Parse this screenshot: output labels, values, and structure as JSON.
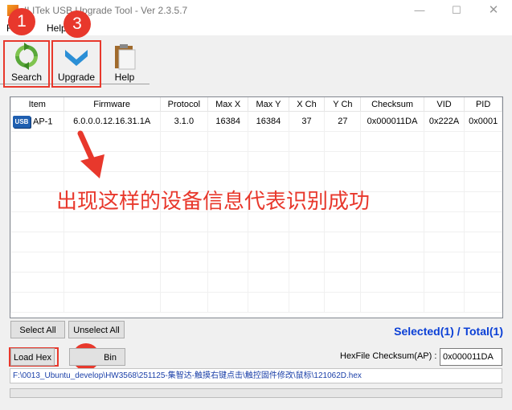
{
  "window": {
    "title": "ILITek USB Upgrade Tool - Ver 2.3.5.7"
  },
  "menu": {
    "items": [
      {
        "label": "File"
      },
      {
        "label": "Help"
      }
    ]
  },
  "toolbar": {
    "search_label": "Search",
    "upgrade_label": "Upgrade",
    "help_label": "Help"
  },
  "badges": {
    "one": "1",
    "two": "2",
    "three": "3"
  },
  "table": {
    "columns": [
      "Item",
      "Firmware",
      "Protocol",
      "Max X",
      "Max Y",
      "X Ch",
      "Y Ch",
      "Checksum",
      "VID",
      "PID"
    ],
    "rows": [
      {
        "icon": "usb-icon",
        "icon_text": "USB",
        "item": "AP-1",
        "firmware": "6.0.0.0.12.16.31.1A",
        "protocol": "3.1.0",
        "max_x": "16384",
        "max_y": "16384",
        "x_ch": "37",
        "y_ch": "27",
        "checksum": "0x000011DA",
        "vid": "0x222A",
        "pid": "0x0001"
      }
    ]
  },
  "annotation": {
    "text": "出现这样的设备信息代表识别成功",
    "color": "#e8382c"
  },
  "buttons": {
    "select_all": "Select All",
    "unselect_all": "Unselect All",
    "load_hex": "Load Hex",
    "load_bin": "Bin"
  },
  "selection": {
    "text": "Selected(1) / Total(1)",
    "color": "#0a3fd6"
  },
  "hexfile": {
    "label": "HexFile Checksum(AP) :",
    "value": "0x000011DA"
  },
  "file_path": "F:\\0013_Ubuntu_develop\\HW3568\\251125-集智达-触摸右键点击\\触控固件修改\\鼠标\\121062D.hex"
}
